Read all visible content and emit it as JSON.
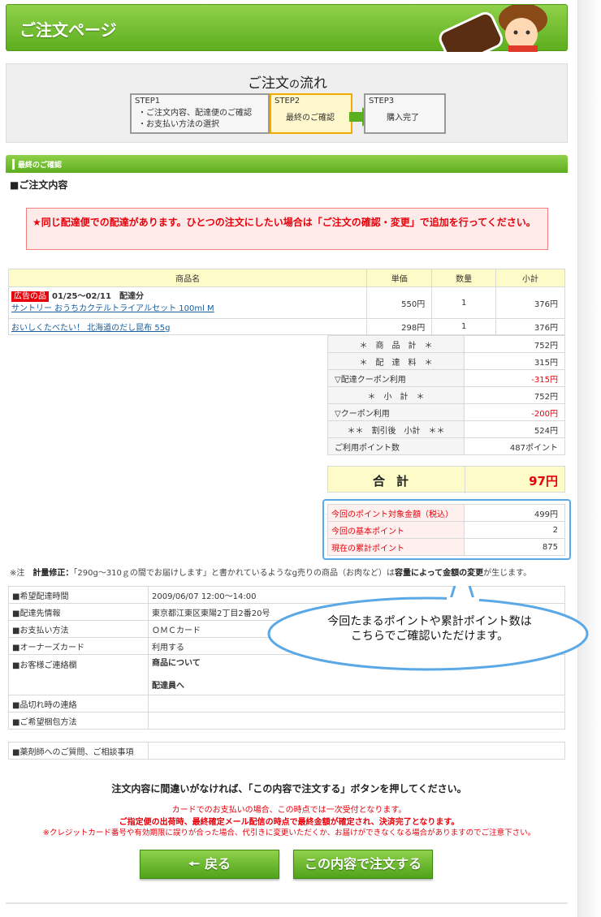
{
  "header": {
    "title": "ご注文ページ"
  },
  "flow": {
    "title_main": "ご注文",
    "title_small": "の",
    "title_end": "流れ",
    "steps": [
      {
        "label": "STEP1",
        "line1": "・ご注文内容、配達便のご確認",
        "line2": "・お支払い方法の選択"
      },
      {
        "label": "STEP2",
        "line1": "最終のご確認"
      },
      {
        "label": "STEP3",
        "line1": "購入完了"
      }
    ]
  },
  "section": {
    "bar_title": "最終のご確認",
    "heading": "■ご注文内容"
  },
  "warning": "★同じ配達便での配達があります。ひとつの注文にしたい場合は「ご注文の確認・変更」で追加を行ってください。",
  "items": {
    "headers": [
      "商品名",
      "単価",
      "数量",
      "小計"
    ],
    "rows": [
      {
        "tag": "広告の品",
        "period": "01/25〜02/11　配達分",
        "name": "サントリー おうちカクテルトライアルセット 100ml M",
        "price": "550円",
        "qty": "1",
        "subtotal": "376円"
      },
      {
        "name": "おいしくたべたい！ 北海道のだし昆布 55g",
        "price": "298円",
        "qty": "1",
        "subtotal": "376円"
      }
    ]
  },
  "summary": [
    {
      "label": "＊　商　品　計　＊",
      "value": "752円"
    },
    {
      "label": "＊　配　達　料　＊",
      "value": "315円"
    },
    {
      "label": "▽配達クーポン利用",
      "value": "-315円"
    },
    {
      "label": "＊　小　計　＊",
      "value": "752円"
    },
    {
      "label": "▽クーポン利用",
      "value": "-200円"
    },
    {
      "label": "＊＊　割引後　小計　＊＊",
      "value": "524円"
    },
    {
      "label": "ご利用ポイント数",
      "value": "487ポイント"
    }
  ],
  "total": {
    "label": "合計",
    "value": "97円"
  },
  "points": [
    {
      "label": "今回のポイント対象金額（税込）",
      "value": "499円"
    },
    {
      "label": "今回の基本ポイント",
      "value": "2"
    },
    {
      "label": "現在の累計ポイント",
      "value": "875"
    }
  ],
  "note": {
    "prefix": "※注　",
    "bold": "計量修正：",
    "text": "「290g〜310ｇの間でお届けします」と書かれているようなg売りの商品（お肉など）は",
    "bold2": "容量によって金額の変更",
    "text2": "が生じます。"
  },
  "info": [
    {
      "label": "■希望配達時間",
      "value": "2009/06/07 12:00〜14:00"
    },
    {
      "label": "■配達先情報",
      "value": "東京都江東区東陽2丁目2番20号"
    },
    {
      "label": "■お支払い方法",
      "value": "ＯＭＣカード"
    },
    {
      "label": "■オーナーズカード",
      "value": "利用する"
    },
    {
      "label": "■お客様ご連絡欄",
      "value1": "商品について",
      "value2": "配達員へ"
    },
    {
      "label": "■品切れ時の連絡",
      "value": ""
    },
    {
      "label": "■ご希望梱包方法",
      "value": ""
    }
  ],
  "pharmacist": {
    "label": "■薬剤師へのご質問、ご相談事項"
  },
  "bubble": {
    "line1": "今回たまるポイントや累計ポイント数は",
    "line2": "こちらでご確認いただけます。"
  },
  "bottom": {
    "confirm": "注文内容に間違いがなければ、「この内容で注文する」ボタンを押してください。",
    "red1": "カードでのお支払いの場合、この時点では一次受付となります。",
    "red2": "ご指定便の出荷時、最終確定メール配信の時点で最終金額が確定され、決済完了となります。",
    "red3": "※クレジットカード番号や有効期限に誤りが合った場合、代引きに変更いただくか、お届けができなくなる場合がありますのでご注意下さい。",
    "back_label": "戻る",
    "order_label": "この内容で注文する"
  },
  "colors": {
    "accent_green": "#5eae1f",
    "alert_red": "#e8000b",
    "callout_blue": "#5aa8e6"
  }
}
